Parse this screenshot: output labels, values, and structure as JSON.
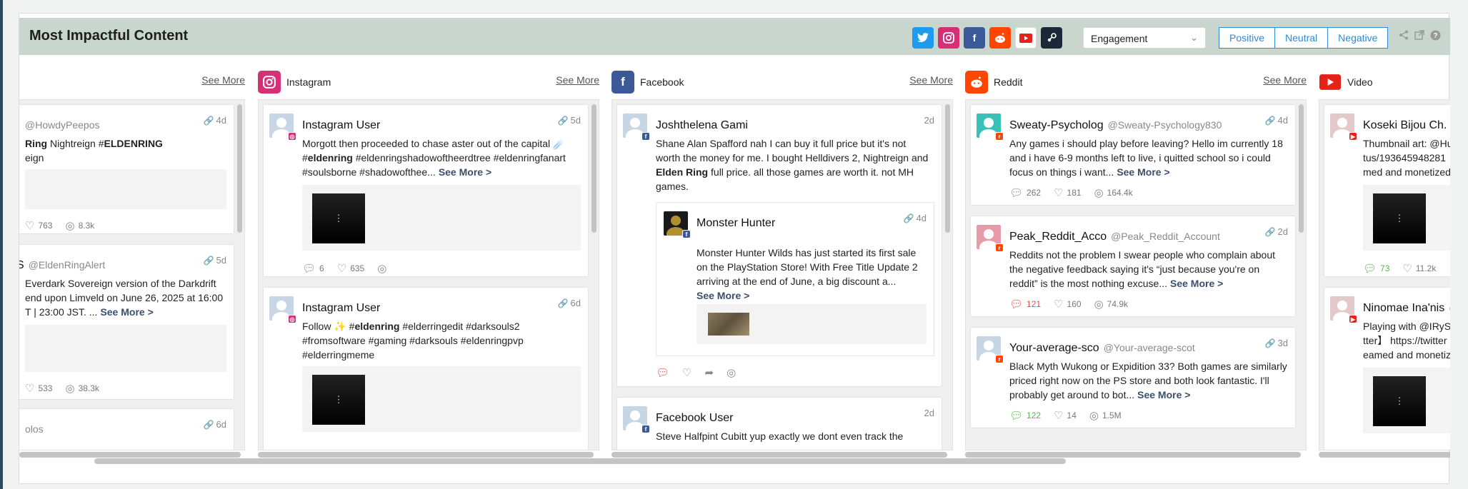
{
  "header": {
    "title": "Most Impactful Content",
    "social_icons": [
      "twitter-icon",
      "instagram-icon",
      "facebook-icon",
      "reddit-icon",
      "video-icon",
      "steam-icon"
    ],
    "metric_select": "Engagement",
    "sentiments": [
      "Positive",
      "Neutral",
      "Negative"
    ]
  },
  "columns": [
    {
      "name": "",
      "see_more": "See More",
      "cards": [
        {
          "author": "",
          "handle": "@HowdyPeepos",
          "time": "4d",
          "text_html": "<b>Ring</b> Nightreign #<b>ELDENRING</b><br>eign",
          "comments": "",
          "likes": "763",
          "reach": "8.3k"
        },
        {
          "author": "S",
          "handle": "@EldenRingAlert",
          "time": "5d",
          "text_html": "Everdark Sovereign version of the Darkdrift<br>end upon Limveld on June 26, 2025 at 16:00<br>T | 23:00 JST. ...",
          "see_more": "See More >",
          "comments": "",
          "likes": "533",
          "reach": "38.3k"
        },
        {
          "author": "",
          "handle": "olos",
          "time": "6d"
        }
      ]
    },
    {
      "name": "Instagram",
      "see_more": "See More",
      "cards": [
        {
          "author": "Instagram User",
          "time": "5d",
          "text_html": "Morgott then proceeded to chase aster out of the capital ☄️<br>#<b>eldenring</b> #eldenringshadowoftheerdtree #eldenringfanart<br>#soulsborne #shadowofthee...",
          "see_more": "See More >",
          "comments": "6",
          "likes": "635",
          "reach": ""
        },
        {
          "author": "Instagram User",
          "time": "6d",
          "text_html": "Follow ✨ #<b>eldenring</b> #elderringedit #darksouls2<br>#fromsoftware #gaming #darksouls #eldenringpvp<br>#elderringmeme",
          "comments": "",
          "likes": "",
          "reach": ""
        }
      ]
    },
    {
      "name": "Facebook",
      "see_more": "See More",
      "cards": [
        {
          "author": "Joshthelena Gami",
          "time": "2d",
          "text_html": "Shane Alan Spafford nah I can buy it full price but it's not<br>worth the money for me. I bought Helldivers 2, Nightreign and<br><b>Elden Ring</b> full price. all those games are worth it. not MH<br>games.",
          "quoted": {
            "author": "Monster Hunter",
            "time": "4d",
            "text": "Monster Hunter Wilds has just started its first sale on the PlayStation Store! With Free Title Update 2 arriving at the end of June, a big discount a...",
            "see_more": "See More >"
          }
        },
        {
          "author": "Facebook User",
          "time": "2d",
          "text_html": "Steve Halfpint Cubitt yup exactly we dont even track the"
        }
      ]
    },
    {
      "name": "Reddit",
      "see_more": "See More",
      "cards": [
        {
          "author": "Sweaty-Psycholog",
          "handle": "@Sweaty-Psychology830",
          "time": "4d",
          "text_html": "Any games i should play before leaving? Hello im currently 18<br>and i have 6-9 months left to live, i quitted school so i could<br>focus on things i want...",
          "see_more": "See More >",
          "comments": "262",
          "likes": "181",
          "reach": "164.4k"
        },
        {
          "author": "Peak_Reddit_Acco",
          "handle": "@Peak_Reddit_Account",
          "time": "2d",
          "text_html": "Reddits not the problem I swear people who complain about<br>the negative feedback saying it's “just because you're on<br>reddit” is the most nothing excuse...",
          "see_more": "See More >",
          "comments": "121",
          "likes": "160",
          "reach": "74.9k"
        },
        {
          "author": "Your-average-sco",
          "handle": "@Your-average-scot",
          "time": "3d",
          "text_html": "Black Myth Wukong or Expidition 33? Both games are similarly<br>priced right now on the PS store and both look fantastic. I'll<br>probably get around to bot...",
          "see_more": "See More >",
          "comments": "122",
          "likes": "14",
          "reach": "1.5M"
        }
      ]
    },
    {
      "name": "Video",
      "see_more": "",
      "cards": [
        {
          "author": "Koseki Bijou Ch.",
          "time": "",
          "text_html": "Thumbnail art: @Hu<br>tus/193645948281<br>med and monetized",
          "comments": "73",
          "likes": "11.2k",
          "reach": ""
        },
        {
          "author": "Ninomae Ina'nis",
          "handle": "@",
          "time": "",
          "text_html": "Playing with @IRyS<br>tter】 https://twitter<br>eamed and monetiz",
          "comments": "",
          "likes": "",
          "reach": ""
        }
      ]
    }
  ]
}
